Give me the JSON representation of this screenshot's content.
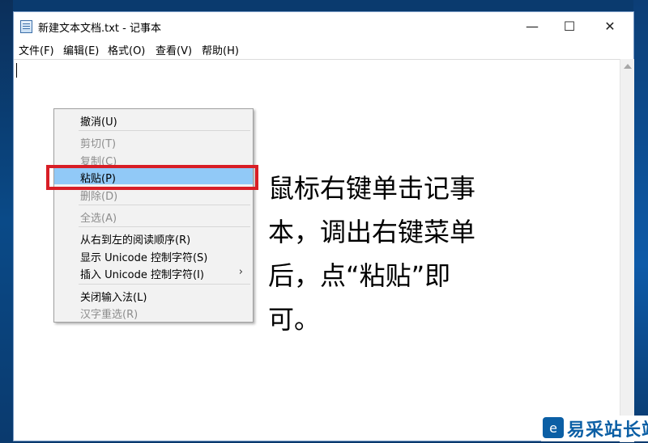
{
  "window": {
    "title": "新建文本文档.txt - 记事本",
    "minimize": "—",
    "maximize": "☐",
    "close": "✕"
  },
  "menubar": {
    "items": [
      "文件(F)",
      "编辑(E)",
      "格式(O)",
      "查看(V)",
      "帮助(H)"
    ]
  },
  "context_menu": {
    "items": [
      {
        "label": "撤消(U)",
        "enabled": true
      },
      {
        "label": "剪切(T)",
        "enabled": false
      },
      {
        "label": "复制(C)",
        "enabled": false
      },
      {
        "label": "粘贴(P)",
        "enabled": true,
        "highlighted": true
      },
      {
        "label": "删除(D)",
        "enabled": false
      },
      {
        "label": "全选(A)",
        "enabled": false
      },
      {
        "label": "从右到左的阅读顺序(R)",
        "enabled": true
      },
      {
        "label": "显示 Unicode 控制字符(S)",
        "enabled": true
      },
      {
        "label": "插入 Unicode 控制字符(I)",
        "enabled": true,
        "submenu_arrow": "›"
      },
      {
        "label": "关闭输入法(L)",
        "enabled": true
      },
      {
        "label": "汉字重选(R)",
        "enabled": false
      }
    ]
  },
  "annotation": {
    "lines": [
      "鼠标右键单击记事",
      "本，调出右键菜单",
      "后，点“粘贴”即",
      "可。"
    ]
  },
  "watermark": {
    "logo_text": "易采站长站"
  }
}
